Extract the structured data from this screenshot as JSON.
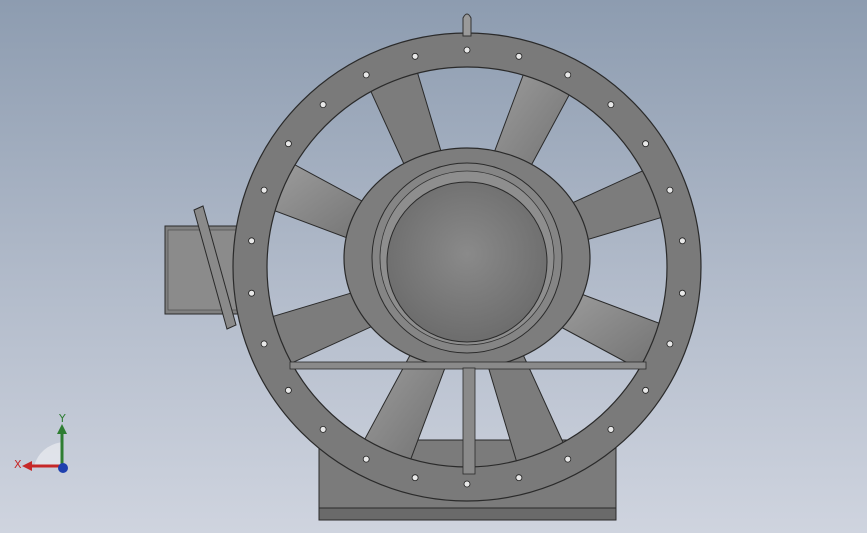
{
  "scene": {
    "model": "axial-fan-assembly",
    "view": "front",
    "blade_count": 8,
    "flange_hole_count": 26,
    "colors": {
      "background_top": "#8d9cb0",
      "background_bottom": "#cfd4df",
      "body": "#7d7d7d",
      "body_light": "#9a9a9a",
      "body_dark": "#5e5e5e",
      "edge": "#2a2a2a"
    }
  },
  "triad": {
    "x_label": "X",
    "y_label": "Y",
    "x_color": "#c62828",
    "y_color": "#2e7d32",
    "z_color": "#1e40af"
  }
}
